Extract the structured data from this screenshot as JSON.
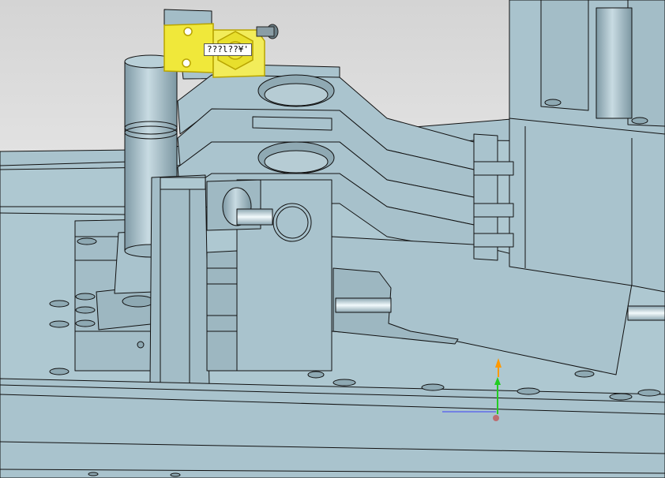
{
  "viewport": {
    "background_top": "#dadada",
    "background_bottom": "#ffffff",
    "model_face": "#a9c3cd",
    "model_edge": "#111111",
    "highlight_color": "#f0e83a"
  },
  "selection_tooltip": {
    "text": "???l??¥'"
  },
  "triad": {
    "icon": "axis-triad-icon",
    "z_color": "#ff9900",
    "y_color": "#22cc22",
    "x_color": "#3333ff"
  }
}
